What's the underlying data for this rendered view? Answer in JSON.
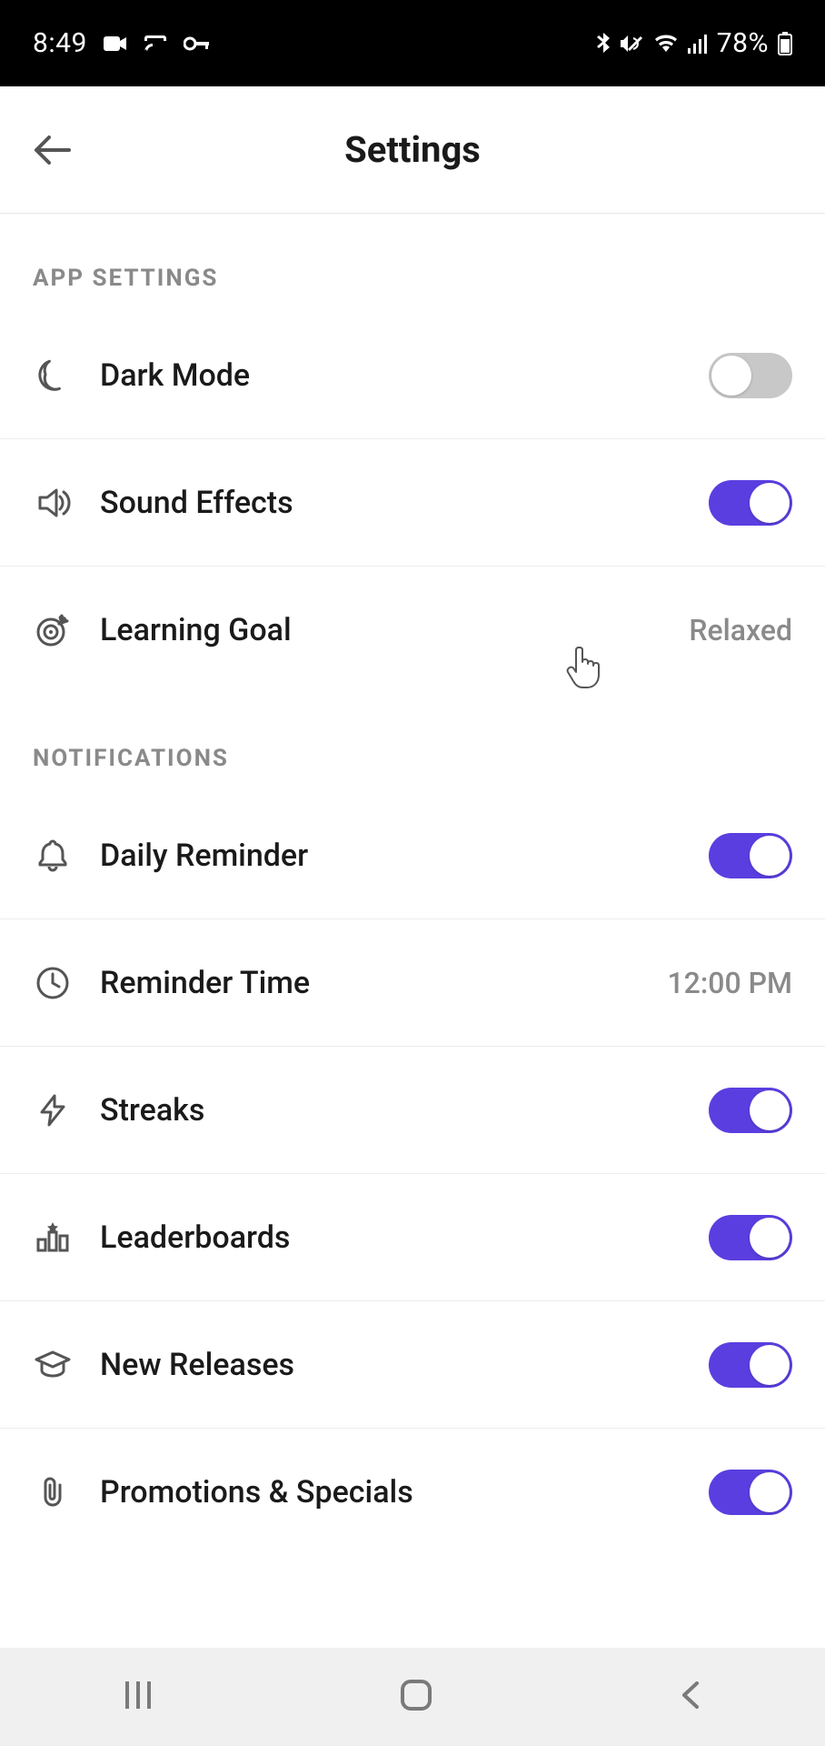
{
  "status_bar": {
    "time": "8:49",
    "battery_text": "78%"
  },
  "header": {
    "title": "Settings"
  },
  "sections": {
    "app_settings": {
      "header": "APP SETTINGS",
      "dark_mode_label": "Dark Mode",
      "dark_mode_on": false,
      "sound_effects_label": "Sound Effects",
      "sound_effects_on": true,
      "learning_goal_label": "Learning Goal",
      "learning_goal_value": "Relaxed"
    },
    "notifications": {
      "header": "NOTIFICATIONS",
      "daily_reminder_label": "Daily Reminder",
      "daily_reminder_on": true,
      "reminder_time_label": "Reminder Time",
      "reminder_time_value": "12:00 PM",
      "streaks_label": "Streaks",
      "streaks_on": true,
      "leaderboards_label": "Leaderboards",
      "leaderboards_on": true,
      "new_releases_label": "New Releases",
      "new_releases_on": true,
      "promotions_label": "Promotions & Specials",
      "promotions_on": true
    }
  }
}
